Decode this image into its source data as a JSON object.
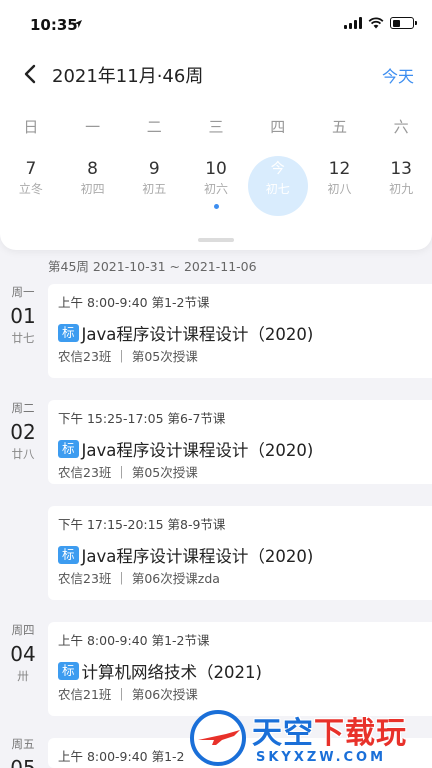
{
  "status": {
    "time": "10:35"
  },
  "nav": {
    "title": "2021年11月·46周",
    "today_label": "今天"
  },
  "weekdays": [
    "日",
    "一",
    "二",
    "三",
    "四",
    "五",
    "六"
  ],
  "dates": [
    {
      "num": "7",
      "lunar": "立冬"
    },
    {
      "num": "8",
      "lunar": "初四"
    },
    {
      "num": "9",
      "lunar": "初五"
    },
    {
      "num": "10",
      "lunar": "初六"
    },
    {
      "num": "今",
      "lunar": "初七"
    },
    {
      "num": "12",
      "lunar": "初八"
    },
    {
      "num": "13",
      "lunar": "初九"
    }
  ],
  "week_header": "第45周 2021-10-31 ~ 2021-11-06",
  "days": [
    {
      "week": "周一",
      "num": "01",
      "lunar": "廿七"
    },
    {
      "week": "周二",
      "num": "02",
      "lunar": "廿八"
    },
    {
      "week": "周四",
      "num": "04",
      "lunar": "卅"
    },
    {
      "week": "周五",
      "num": "05",
      "lunar": ""
    }
  ],
  "courses": [
    {
      "time": "上午 8:00-9:40  第1-2节课",
      "badge": "标",
      "title": "Java程序设计课程设计（2020)",
      "info": "农信23班 ｜ 第05次授课"
    },
    {
      "time": "下午 15:25-17:05  第6-7节课",
      "badge": "标",
      "title": "Java程序设计课程设计（2020)",
      "info": "农信23班 ｜ 第05次授课"
    },
    {
      "time": "下午 17:15-20:15  第8-9节课",
      "badge": "标",
      "title": "Java程序设计课程设计（2020)",
      "info": "农信23班 ｜ 第06次授课zda"
    },
    {
      "time": "上午 8:00-9:40  第1-2节课",
      "badge": "标",
      "title": "计算机网络技术（2021)",
      "info": "农信21班 ｜ 第06次授课"
    },
    {
      "time": "上午 8:00-9:40  第1-2",
      "badge": "",
      "title": "",
      "info": ""
    }
  ],
  "watermark": {
    "main": "天空",
    "accent": "下载玩",
    "sub": "SKYXZW.COM"
  },
  "colors": {
    "accent": "#3d8ef0",
    "badge": "#3d9cf0",
    "today_circle": "#d9ecfd",
    "background": "#f3f3f7"
  }
}
